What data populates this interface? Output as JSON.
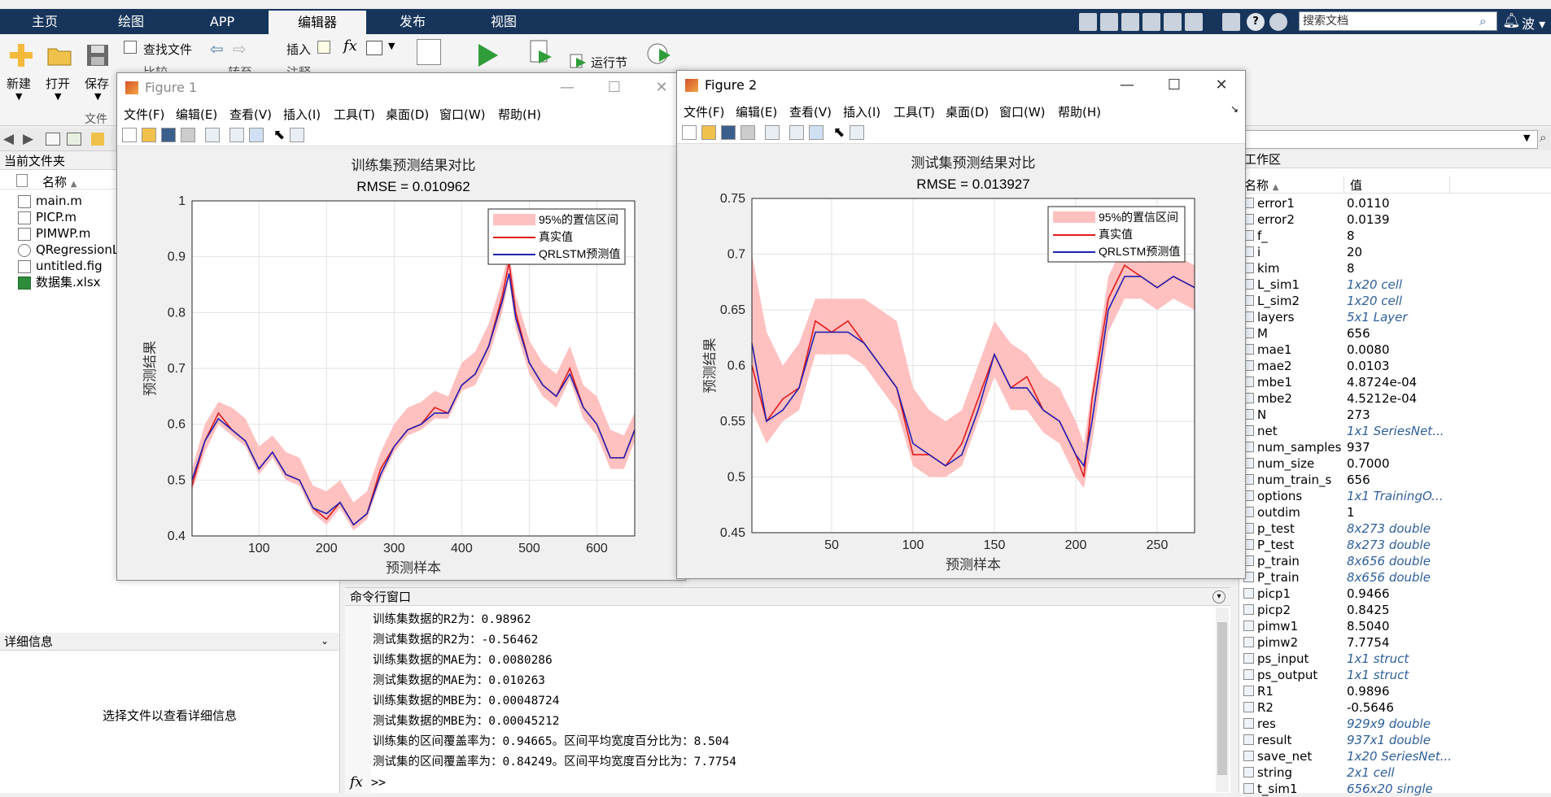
{
  "ribbon_tabs": [
    "主页",
    "绘图",
    "APP",
    "编辑器",
    "发布",
    "视图"
  ],
  "active_tab": "编辑器",
  "search": {
    "placeholder": "搜索文档"
  },
  "user": "波",
  "ribbon": {
    "new": "新建",
    "open": "打开",
    "save": "保存",
    "find_files": "查找文件",
    "compare": "比较",
    "goto": "转至",
    "insert": "插入",
    "comment": "注释",
    "run_section": "运行节",
    "file_group": "文件"
  },
  "current_folder": {
    "title": "当前文件夹",
    "col_name": "名称",
    "files": [
      "main.m",
      "PICP.m",
      "PIMWP.m",
      "QRegressionL",
      "untitled.fig",
      "数据集.xlsx"
    ]
  },
  "details": {
    "title": "详细信息",
    "hint": "选择文件以查看详细信息"
  },
  "command_window": {
    "title": "命令行窗口",
    "lines": [
      "训练集数据的R2为：0.98962",
      "测试集数据的R2为：-0.56462",
      "训练集数据的MAE为：0.0080286",
      "测试集数据的MAE为：0.010263",
      "训练集数据的MBE为：0.00048724",
      "测试集数据的MBE为：0.00045212",
      "训练集的区间覆盖率为：0.94665。区间平均宽度百分比为：8.504",
      "测试集的区间覆盖率为：0.84249。区间平均宽度百分比为：7.7754"
    ],
    "prompt": ">>"
  },
  "workspace": {
    "title": "工作区",
    "col_name": "名称",
    "col_value": "值",
    "vars": [
      {
        "name": "error1",
        "value": "0.0110"
      },
      {
        "name": "error2",
        "value": "0.0139"
      },
      {
        "name": "f_",
        "value": "8"
      },
      {
        "name": "i",
        "value": "20"
      },
      {
        "name": "kim",
        "value": "8"
      },
      {
        "name": "L_sim1",
        "value": "1x20 cell"
      },
      {
        "name": "L_sim2",
        "value": "1x20 cell"
      },
      {
        "name": "layers",
        "value": "5x1 Layer"
      },
      {
        "name": "M",
        "value": "656"
      },
      {
        "name": "mae1",
        "value": "0.0080"
      },
      {
        "name": "mae2",
        "value": "0.0103"
      },
      {
        "name": "mbe1",
        "value": "4.8724e-04"
      },
      {
        "name": "mbe2",
        "value": "4.5212e-04"
      },
      {
        "name": "N",
        "value": "273"
      },
      {
        "name": "net",
        "value": "1x1 SeriesNet..."
      },
      {
        "name": "num_samples",
        "value": "937"
      },
      {
        "name": "num_size",
        "value": "0.7000"
      },
      {
        "name": "num_train_s",
        "value": "656"
      },
      {
        "name": "options",
        "value": "1x1 TrainingO..."
      },
      {
        "name": "outdim",
        "value": "1"
      },
      {
        "name": "p_test",
        "value": "8x273 double"
      },
      {
        "name": "P_test",
        "value": "8x273 double"
      },
      {
        "name": "p_train",
        "value": "8x656 double"
      },
      {
        "name": "P_train",
        "value": "8x656 double"
      },
      {
        "name": "picp1",
        "value": "0.9466"
      },
      {
        "name": "picp2",
        "value": "0.8425"
      },
      {
        "name": "pimw1",
        "value": "8.5040"
      },
      {
        "name": "pimw2",
        "value": "7.7754"
      },
      {
        "name": "ps_input",
        "value": "1x1 struct"
      },
      {
        "name": "ps_output",
        "value": "1x1 struct"
      },
      {
        "name": "R1",
        "value": "0.9896"
      },
      {
        "name": "R2",
        "value": "-0.5646"
      },
      {
        "name": "res",
        "value": "929x9 double"
      },
      {
        "name": "result",
        "value": "937x1 double"
      },
      {
        "name": "save_net",
        "value": "1x20 SeriesNet..."
      },
      {
        "name": "string",
        "value": "2x1 cell"
      },
      {
        "name": "t_sim1",
        "value": "656x20 single"
      }
    ]
  },
  "fig_menu": [
    "文件(F)",
    "编辑(E)",
    "查看(V)",
    "插入(I)",
    "工具(T)",
    "桌面(D)",
    "窗口(W)",
    "帮助(H)"
  ],
  "figure1": {
    "window_title": "Figure 1"
  },
  "figure2": {
    "window_title": "Figure 2"
  },
  "chart_data": [
    {
      "type": "line",
      "title": "训练集预测结果对比",
      "subtitle": "RMSE = 0.010962",
      "xlabel": "预测样本",
      "ylabel": "预测结果",
      "xlim": [
        1,
        656
      ],
      "ylim": [
        0.4,
        1.0
      ],
      "xticks": [
        100,
        200,
        300,
        400,
        500,
        600
      ],
      "yticks": [
        0.4,
        0.5,
        0.6,
        0.7,
        0.8,
        0.9,
        1
      ],
      "grid": true,
      "legend_position": "top-right",
      "legend": [
        "95%的置信区间",
        "真实值",
        "QRLSTM预测值"
      ],
      "colors": {
        "band": "#ffc0c0",
        "true": "#e31a1c",
        "pred": "#2020b0"
      },
      "x": [
        1,
        20,
        40,
        60,
        80,
        100,
        120,
        140,
        160,
        180,
        200,
        220,
        240,
        260,
        280,
        300,
        320,
        340,
        360,
        380,
        400,
        420,
        440,
        460,
        470,
        480,
        500,
        520,
        540,
        560,
        580,
        600,
        620,
        640,
        656
      ],
      "series": [
        {
          "name": "真实值",
          "values": [
            0.49,
            0.57,
            0.62,
            0.59,
            0.57,
            0.52,
            0.55,
            0.51,
            0.5,
            0.45,
            0.43,
            0.46,
            0.42,
            0.44,
            0.52,
            0.56,
            0.59,
            0.6,
            0.63,
            0.62,
            0.67,
            0.69,
            0.74,
            0.83,
            0.89,
            0.8,
            0.71,
            0.67,
            0.65,
            0.7,
            0.63,
            0.6,
            0.54,
            0.54,
            0.59
          ]
        },
        {
          "name": "QRLSTM预测值",
          "values": [
            0.5,
            0.57,
            0.61,
            0.59,
            0.57,
            0.52,
            0.55,
            0.51,
            0.5,
            0.45,
            0.44,
            0.46,
            0.42,
            0.44,
            0.51,
            0.56,
            0.59,
            0.6,
            0.62,
            0.62,
            0.67,
            0.69,
            0.74,
            0.82,
            0.87,
            0.79,
            0.71,
            0.67,
            0.65,
            0.69,
            0.63,
            0.6,
            0.54,
            0.54,
            0.59
          ]
        }
      ],
      "band_lower": [
        0.48,
        0.55,
        0.6,
        0.58,
        0.56,
        0.51,
        0.54,
        0.5,
        0.49,
        0.44,
        0.42,
        0.45,
        0.41,
        0.43,
        0.5,
        0.55,
        0.58,
        0.59,
        0.61,
        0.61,
        0.66,
        0.67,
        0.72,
        0.8,
        0.86,
        0.77,
        0.69,
        0.65,
        0.63,
        0.68,
        0.61,
        0.58,
        0.52,
        0.52,
        0.57
      ],
      "band_upper": [
        0.52,
        0.6,
        0.64,
        0.63,
        0.61,
        0.56,
        0.58,
        0.55,
        0.54,
        0.49,
        0.48,
        0.5,
        0.46,
        0.48,
        0.55,
        0.6,
        0.63,
        0.64,
        0.66,
        0.65,
        0.71,
        0.73,
        0.78,
        0.86,
        0.91,
        0.83,
        0.75,
        0.71,
        0.69,
        0.74,
        0.67,
        0.65,
        0.59,
        0.58,
        0.62
      ]
    },
    {
      "type": "line",
      "title": "测试集预测结果对比",
      "subtitle": "RMSE = 0.013927",
      "xlabel": "预测样本",
      "ylabel": "预测结果",
      "xlim": [
        1,
        273
      ],
      "ylim": [
        0.45,
        0.75
      ],
      "xticks": [
        50,
        100,
        150,
        200,
        250
      ],
      "yticks": [
        0.45,
        0.5,
        0.55,
        0.6,
        0.65,
        0.7,
        0.75
      ],
      "grid": true,
      "legend_position": "top-right",
      "legend": [
        "95%的置信区间",
        "真实值",
        "QRLSTM预测值"
      ],
      "colors": {
        "band": "#ffc0c0",
        "true": "#e31a1c",
        "pred": "#2020b0"
      },
      "x": [
        1,
        10,
        20,
        30,
        40,
        50,
        60,
        70,
        80,
        90,
        100,
        110,
        120,
        130,
        140,
        150,
        160,
        170,
        180,
        190,
        200,
        205,
        210,
        220,
        230,
        240,
        250,
        260,
        273
      ],
      "series": [
        {
          "name": "真实值",
          "values": [
            0.6,
            0.55,
            0.57,
            0.58,
            0.64,
            0.63,
            0.64,
            0.62,
            0.6,
            0.58,
            0.52,
            0.52,
            0.51,
            0.53,
            0.57,
            0.61,
            0.58,
            0.59,
            0.56,
            0.55,
            0.52,
            0.5,
            0.57,
            0.66,
            0.69,
            0.68,
            0.67,
            0.68,
            0.67
          ]
        },
        {
          "name": "QRLSTM预测值",
          "values": [
            0.62,
            0.55,
            0.56,
            0.58,
            0.63,
            0.63,
            0.63,
            0.62,
            0.6,
            0.58,
            0.53,
            0.52,
            0.51,
            0.52,
            0.56,
            0.61,
            0.58,
            0.58,
            0.56,
            0.55,
            0.52,
            0.51,
            0.55,
            0.65,
            0.68,
            0.68,
            0.67,
            0.68,
            0.67
          ]
        }
      ],
      "band_lower": [
        0.56,
        0.53,
        0.55,
        0.56,
        0.61,
        0.61,
        0.61,
        0.6,
        0.58,
        0.56,
        0.51,
        0.5,
        0.5,
        0.51,
        0.55,
        0.59,
        0.56,
        0.56,
        0.54,
        0.53,
        0.5,
        0.49,
        0.53,
        0.63,
        0.66,
        0.66,
        0.65,
        0.66,
        0.65
      ],
      "band_upper": [
        0.7,
        0.63,
        0.6,
        0.62,
        0.66,
        0.66,
        0.66,
        0.66,
        0.65,
        0.64,
        0.58,
        0.56,
        0.55,
        0.56,
        0.6,
        0.64,
        0.62,
        0.61,
        0.59,
        0.58,
        0.55,
        0.53,
        0.58,
        0.68,
        0.71,
        0.71,
        0.7,
        0.7,
        0.69
      ]
    }
  ]
}
